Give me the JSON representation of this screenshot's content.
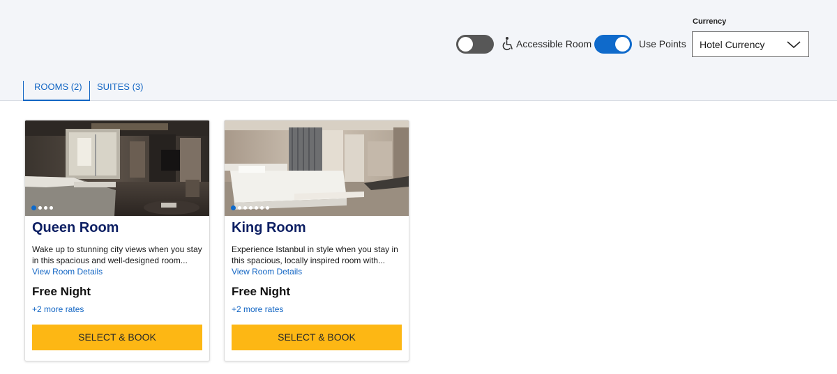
{
  "filters": {
    "accessible_room": {
      "label": "Accessible Room",
      "enabled": false
    },
    "use_points": {
      "label": "Use Points",
      "enabled": true
    }
  },
  "currency": {
    "title": "Currency",
    "selected": "Hotel Currency"
  },
  "tabs": [
    {
      "label": "ROOMS (2)",
      "active": true
    },
    {
      "label": "SUITES (3)",
      "active": false
    }
  ],
  "rooms": [
    {
      "name": "Queen Room",
      "description": "Wake up to stunning city views when you stay in this spacious and well-designed room...",
      "details_link": "View Room Details",
      "rate": "Free Night",
      "more_rates": "+2 more rates",
      "book_label": "SELECT & BOOK",
      "photo_count": 4,
      "photo_index": 1
    },
    {
      "name": "King Room",
      "description": "Experience Istanbul in style when you stay in this spacious, locally inspired room with...",
      "details_link": "View Room Details",
      "rate": "Free Night",
      "more_rates": "+2 more rates",
      "book_label": "SELECT & BOOK",
      "photo_count": 7,
      "photo_index": 1
    }
  ],
  "colors": {
    "accent_blue": "#0f6acb",
    "title_navy": "#0d1f63",
    "button_yellow": "#fdb714"
  }
}
